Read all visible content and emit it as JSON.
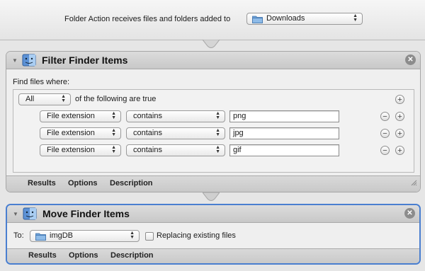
{
  "workflow": {
    "receives_label": "Folder Action receives files and folders added to",
    "folder": "Downloads"
  },
  "filter_action": {
    "title": "Filter Finder Items",
    "find_label": "Find files where:",
    "match_mode": "All",
    "match_suffix": "of the following are true",
    "rules": [
      {
        "attribute": "File extension",
        "operator": "contains",
        "value": "png"
      },
      {
        "attribute": "File extension",
        "operator": "contains",
        "value": "jpg"
      },
      {
        "attribute": "File extension",
        "operator": "contains",
        "value": "gif"
      }
    ],
    "footer": {
      "results": "Results",
      "options": "Options",
      "description": "Description"
    }
  },
  "move_action": {
    "title": "Move Finder Items",
    "to_label": "To:",
    "destination": "imgDB",
    "replacing_label": "Replacing existing files",
    "replacing_checked": false,
    "footer": {
      "results": "Results",
      "options": "Options",
      "description": "Description"
    }
  },
  "icons": {
    "folder": "folder-icon",
    "finder": "finder-icon",
    "close": "close-icon",
    "disclosure": "disclosure-triangle-icon",
    "add": "plus-icon",
    "remove": "minus-icon",
    "popup_arrows": "popup-arrows-icon",
    "resize": "resize-grip-icon"
  },
  "colors": {
    "selection_border": "#4a7fd0"
  }
}
